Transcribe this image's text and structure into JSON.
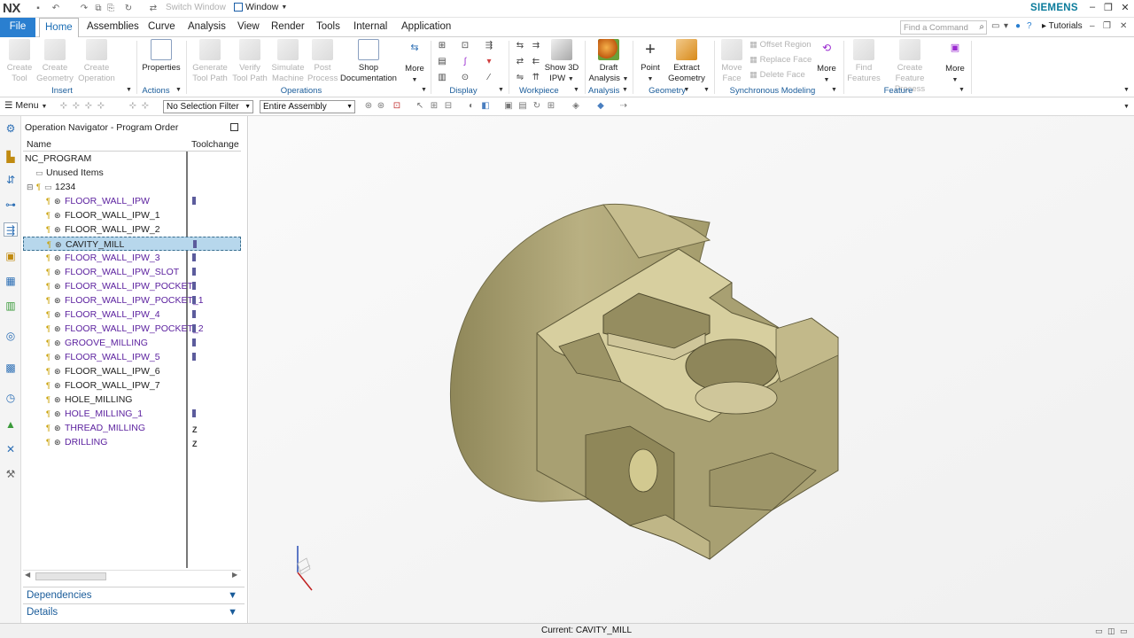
{
  "titlebar": {
    "logo": "NX",
    "switch_window": "Switch Window",
    "window_menu": "Window",
    "brand": "SIEMENS",
    "controls": [
      "–",
      "❐",
      "✕"
    ]
  },
  "tabs": [
    "File",
    "Home",
    "Assemblies",
    "Curve",
    "Analysis",
    "View",
    "Render",
    "Tools",
    "Internal",
    "Application"
  ],
  "find_command_placeholder": "Find a Command",
  "tutorials": "Tutorials",
  "ribbon": {
    "insert": {
      "label": "Insert",
      "buttons": [
        [
          "Create",
          "Tool"
        ],
        [
          "Create",
          "Geometry"
        ],
        [
          "Create",
          "Operation"
        ]
      ]
    },
    "actions": {
      "label": "Actions",
      "properties": "Properties"
    },
    "operations": {
      "label": "Operations",
      "buttons": [
        [
          "Generate",
          "Tool Path"
        ],
        [
          "Verify",
          "Tool Path"
        ],
        [
          "Simulate",
          "Machine"
        ],
        [
          "Post",
          "Process"
        ]
      ],
      "shop_doc": [
        "Shop",
        "Documentation"
      ],
      "more": "More"
    },
    "display": {
      "label": "Display"
    },
    "workpiece": {
      "label": "Workpiece",
      "show3d": [
        "Show 3D",
        "IPW"
      ]
    },
    "analysis": {
      "label": "Analysis",
      "draft": [
        "Draft",
        "Analysis"
      ]
    },
    "geometry": {
      "label": "Geometry",
      "point": "Point",
      "extract": [
        "Extract",
        "Geometry"
      ]
    },
    "sync": {
      "label": "Synchronous Modeling",
      "move_face": [
        "Move",
        "Face"
      ],
      "items": [
        "Offset Region",
        "Replace Face",
        "Delete Face"
      ],
      "more": "More"
    },
    "feature": {
      "label": "Feature",
      "find": [
        "Find",
        "Features"
      ],
      "create_process": [
        "Create Feature",
        "Process"
      ],
      "more": "More"
    }
  },
  "toolbar2": {
    "menu": "Menu",
    "selection_filter": "No Selection Filter",
    "scope": "Entire Assembly"
  },
  "navigator": {
    "title": "Operation Navigator - Program Order",
    "col_name": "Name",
    "col_toolchange": "Toolchange",
    "root": "NC_PROGRAM",
    "unused": "Unused Items",
    "group": "1234",
    "operations": [
      {
        "name": "FLOOR_WALL_IPW",
        "tc": "bar",
        "style": "op"
      },
      {
        "name": "FLOOR_WALL_IPW_1",
        "tc": "",
        "style": "dark"
      },
      {
        "name": "FLOOR_WALL_IPW_2",
        "tc": "",
        "style": "dark"
      },
      {
        "name": "CAVITY_MILL",
        "tc": "bar",
        "style": "dark",
        "selected": true
      },
      {
        "name": "FLOOR_WALL_IPW_3",
        "tc": "bar",
        "style": "op"
      },
      {
        "name": "FLOOR_WALL_IPW_SLOT",
        "tc": "bar",
        "style": "op"
      },
      {
        "name": "FLOOR_WALL_IPW_POCKET",
        "tc": "bar",
        "style": "op"
      },
      {
        "name": "FLOOR_WALL_IPW_POCKET_1",
        "tc": "bar",
        "style": "op"
      },
      {
        "name": "FLOOR_WALL_IPW_4",
        "tc": "bar",
        "style": "op"
      },
      {
        "name": "FLOOR_WALL_IPW_POCKET_2",
        "tc": "bar",
        "style": "op"
      },
      {
        "name": "GROOVE_MILLING",
        "tc": "bar",
        "style": "op"
      },
      {
        "name": "FLOOR_WALL_IPW_5",
        "tc": "bar",
        "style": "op"
      },
      {
        "name": "FLOOR_WALL_IPW_6",
        "tc": "",
        "style": "dark"
      },
      {
        "name": "FLOOR_WALL_IPW_7",
        "tc": "",
        "style": "dark"
      },
      {
        "name": "HOLE_MILLING",
        "tc": "",
        "style": "dark"
      },
      {
        "name": "HOLE_MILLING_1",
        "tc": "bar",
        "style": "op"
      },
      {
        "name": "THREAD_MILLING",
        "tc": "z",
        "style": "op"
      },
      {
        "name": "DRILLING",
        "tc": "z",
        "style": "op"
      }
    ]
  },
  "panels": {
    "dependencies": "Dependencies",
    "details": "Details"
  },
  "status": "Current: CAVITY_MILL",
  "colors": {
    "accent": "#2a7fd0",
    "selection": "#b7d7ec",
    "model": "#cfc69a",
    "op_text": "#5a1f9e"
  }
}
